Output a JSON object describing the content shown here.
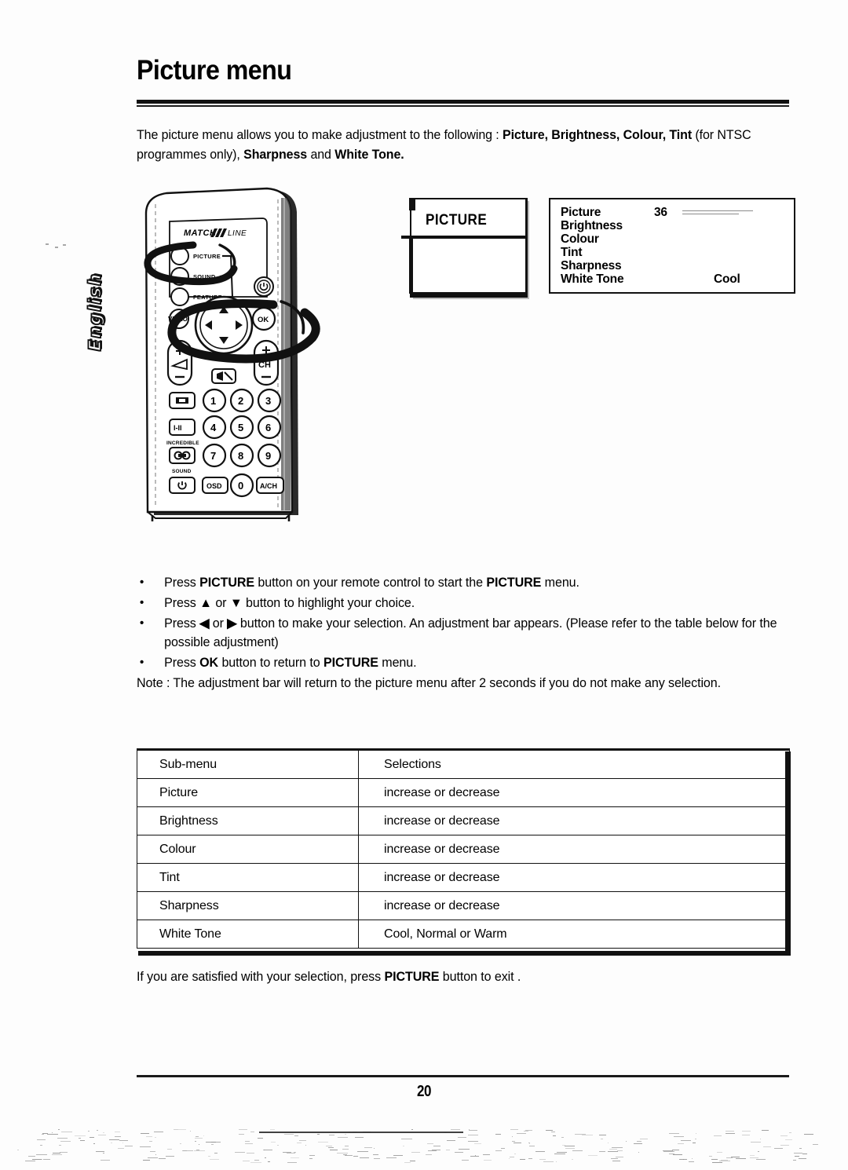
{
  "document": {
    "title": "Picture menu",
    "page_number": "20",
    "language_tab": "English",
    "intro_parts": [
      {
        "text": "The picture menu allows you to make adjustment to the following : ",
        "bold": false
      },
      {
        "text": "Picture, Brightness, Colour, Tint ",
        "bold": true
      },
      {
        "text": "(for NTSC programmes only), ",
        "bold": false
      },
      {
        "text": "Sharpness ",
        "bold": true
      },
      {
        "text": "and ",
        "bold": false
      },
      {
        "text": "White Tone.",
        "bold": true
      }
    ],
    "intro_line1": "The picture menu allows you to make adjustment to the following : Picture, Brightness, Colour,",
    "intro_line2": "Tint (for NTSC programmes only), Sharpness and White Tone."
  },
  "remote": {
    "brand": "MATCH",
    "brand_suffix": "LINE",
    "labels": {
      "picture": "PICTURE",
      "sound": "SOUND",
      "feature": "FEATURE",
      "video": "VIDEO",
      "ok": "OK",
      "ch": "CH",
      "incredible": "INCREDIBLE",
      "incredible_sound": "SOUND",
      "osd": "OSD",
      "ach": "A/CH",
      "i_ii": "I-II"
    },
    "keypad": [
      "1",
      "2",
      "3",
      "4",
      "5",
      "6",
      "7",
      "8",
      "9",
      "0"
    ]
  },
  "osd_title_screen": {
    "title": "PICTURE"
  },
  "osd_menu_screen": {
    "rows": [
      {
        "label": "Picture",
        "value": "36",
        "has_bar": true
      },
      {
        "label": "Brightness",
        "value": "",
        "has_bar": false
      },
      {
        "label": "Colour",
        "value": "",
        "has_bar": false
      },
      {
        "label": "Tint",
        "value": "",
        "has_bar": false
      },
      {
        "label": "Sharpness",
        "value": "",
        "has_bar": false
      },
      {
        "label": "White Tone",
        "value": "",
        "word": "Cool",
        "has_bar": false
      }
    ]
  },
  "instructions": {
    "bullet_marker": "•",
    "items": [
      {
        "id": "start-picture-menu",
        "segments": [
          {
            "t": "Press  ",
            "b": false
          },
          {
            "t": "PICTURE",
            "b": true
          },
          {
            "t": "  button on your remote control to start the  ",
            "b": false
          },
          {
            "t": "PICTURE",
            "b": true
          },
          {
            "t": "  menu.",
            "b": false
          }
        ]
      },
      {
        "id": "highlight-choice",
        "segments": [
          {
            "t": "Press  ",
            "b": false
          },
          {
            "t": "▲",
            "b": true
          },
          {
            "t": "  or  ",
            "b": false
          },
          {
            "t": "▼",
            "b": true
          },
          {
            "t": "  button to highlight your choice.",
            "b": false
          }
        ]
      },
      {
        "id": "make-selection",
        "segments": [
          {
            "t": "Press  ",
            "b": false
          },
          {
            "t": "◀",
            "b": true
          },
          {
            "t": "  or  ",
            "b": false
          },
          {
            "t": "▶",
            "b": true
          },
          {
            "t": "  button to make your selection.  An adjustment bar appears. (Please refer to the table below for the possible adjustment)",
            "b": false
          }
        ]
      },
      {
        "id": "return-to-picture-menu",
        "segments": [
          {
            "t": "Press  ",
            "b": false
          },
          {
            "t": "OK",
            "b": true
          },
          {
            "t": "  button to return to  ",
            "b": false
          },
          {
            "t": "PICTURE",
            "b": true
          },
          {
            "t": "  menu.",
            "b": false
          }
        ]
      }
    ],
    "note": "Note : The adjustment bar will return to the picture menu after 2 seconds if you do not make any selection."
  },
  "table": {
    "headers": [
      "Sub-menu",
      "Selections"
    ],
    "rows": [
      [
        "Picture",
        "increase or decrease"
      ],
      [
        "Brightness",
        "increase or decrease"
      ],
      [
        "Colour",
        "increase or decrease"
      ],
      [
        "Tint",
        "increase or decrease"
      ],
      [
        "Sharpness",
        "increase or decrease"
      ],
      [
        "White Tone",
        "Cool, Normal or Warm"
      ]
    ]
  },
  "closing": {
    "segments": [
      {
        "t": "If you are satisfied with your selection, press  ",
        "b": false
      },
      {
        "t": "PICTURE",
        "b": true
      },
      {
        "t": "  button to exit .",
        "b": false
      }
    ]
  },
  "colors": {
    "ink": "#111111",
    "paper": "#ffffff"
  }
}
